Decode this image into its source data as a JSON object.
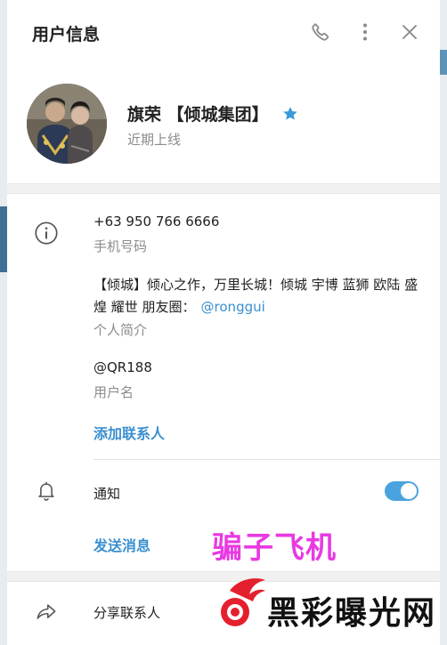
{
  "header": {
    "title": "用户信息",
    "icons": [
      "phone-icon",
      "more-vertical-icon",
      "close-icon"
    ]
  },
  "profile": {
    "name": "旗荣 【倾城集团】",
    "status": "近期上线",
    "badge_icon": "star-icon"
  },
  "info": {
    "phone": "+63 950 766 6666",
    "phone_label": "手机号码",
    "bio_text": "【倾城】倾心之作，万里长城！倾城 宇博 蓝狮 欧陆 盛煌 耀世 朋友圈：",
    "bio_mention": "@ronggui",
    "bio_label": "个人简介",
    "username": "@QR188",
    "username_label": "用户名",
    "add_contact": "添加联系人"
  },
  "notifications": {
    "label": "通知",
    "enabled": true
  },
  "send_message": "发送消息",
  "share_contact": "分享联系人",
  "watermarks": {
    "overlay_text": "骗子飞机",
    "logo_text": "黑彩曝光网"
  },
  "colors": {
    "accent": "#3a8fcf",
    "toggle_on": "#4aa3df",
    "star": "#3a9ad9",
    "overlay_text": "#e83ae2"
  }
}
